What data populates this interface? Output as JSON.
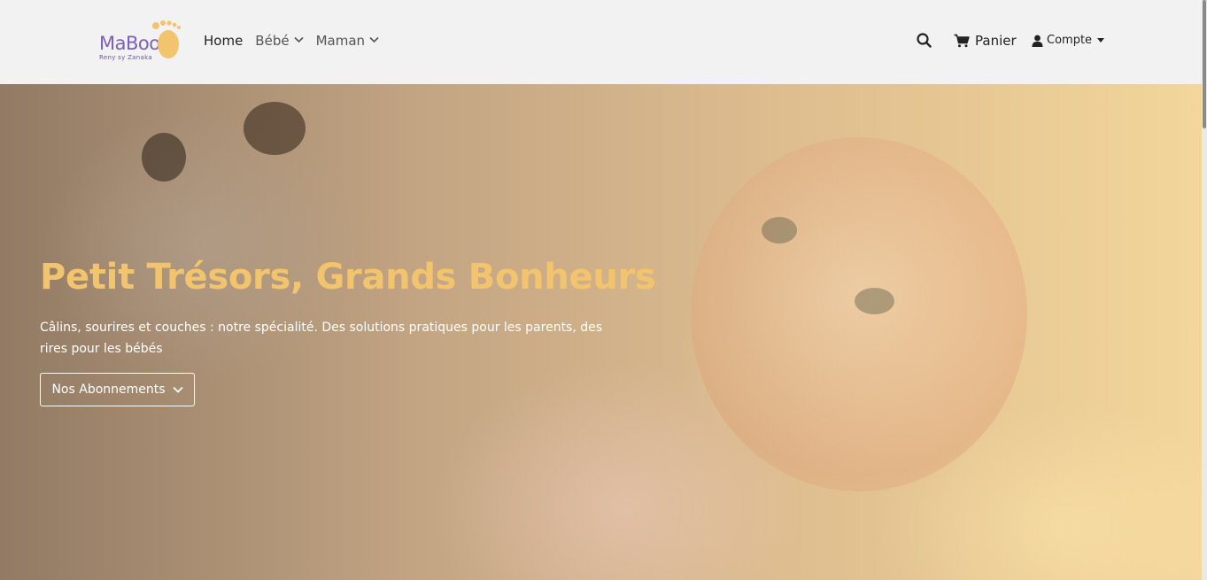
{
  "brand": {
    "name": "MaBoo",
    "tagline": "Reny sy Zanaka",
    "logo_color": "#7b5fb8",
    "foot_color": "#f3c46e"
  },
  "nav": {
    "links": [
      {
        "label": "Home",
        "active": true,
        "dropdown": false
      },
      {
        "label": "Bébé",
        "active": false,
        "dropdown": true
      },
      {
        "label": "Maman",
        "active": false,
        "dropdown": true
      }
    ],
    "search_icon": "search-icon",
    "cart_label": "Panier",
    "account_label": "Compte"
  },
  "hero": {
    "title": "Petit Trésors, Grands Bonheurs",
    "subtitle": "Câlins, sourires et couches : notre spécialité. Des solutions pratiques pour les parents, des rires pour les bébés",
    "button_label": "Nos Abonnements",
    "title_color": "#f3c46e"
  }
}
